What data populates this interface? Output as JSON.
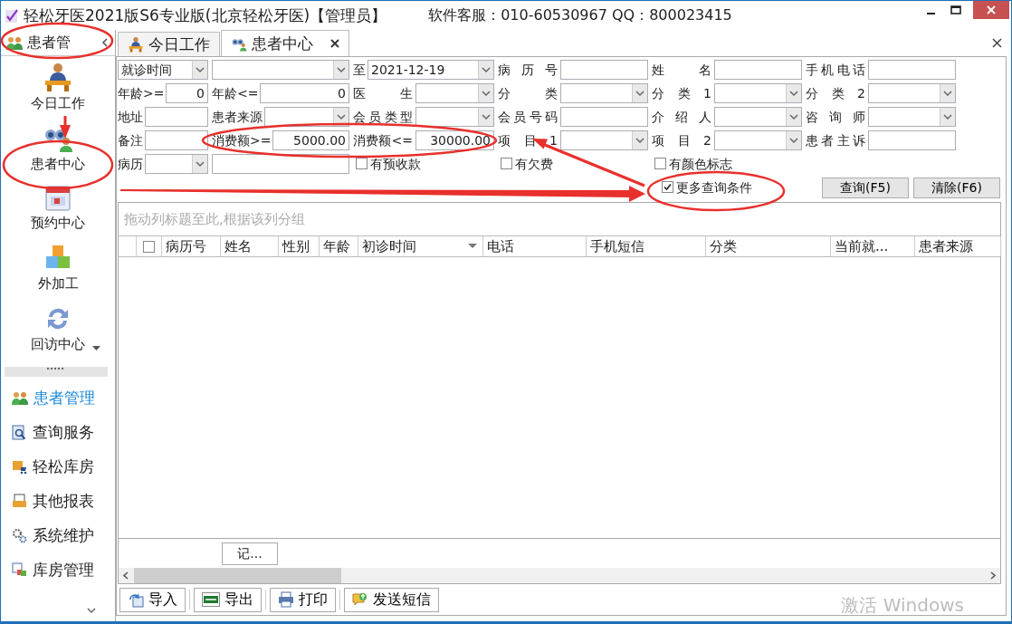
{
  "window": {
    "title": "轻松牙医2021版S6专业版(北京轻松牙医)【管理员】",
    "support": "软件客服：010-60530967 QQ：800023415"
  },
  "sidebar": {
    "header": "患者管",
    "launchers": [
      {
        "label": "今日工作"
      },
      {
        "label": "患者中心"
      },
      {
        "label": "预约中心"
      },
      {
        "label": "外加工"
      },
      {
        "label": "回访中心"
      }
    ],
    "groups": [
      {
        "label": "患者管理",
        "selected": true
      },
      {
        "label": "查询服务",
        "selected": false
      },
      {
        "label": "轻松库房",
        "selected": false
      },
      {
        "label": "其他报表",
        "selected": false
      },
      {
        "label": "系统维护",
        "selected": false
      },
      {
        "label": "库房管理",
        "selected": false
      }
    ]
  },
  "tabs": [
    {
      "label": "今日工作",
      "selected": false,
      "closable": false
    },
    {
      "label": "患者中心",
      "selected": true,
      "closable": true
    }
  ],
  "filters": [
    [
      {
        "kind": "select",
        "value": "就诊时间"
      },
      {
        "kind": "select"
      },
      {
        "label": "至",
        "kind": "select",
        "value": "2021-12-19"
      },
      {
        "label": "病 历 号",
        "kind": "input"
      },
      {
        "label": "姓 名",
        "kind": "input"
      },
      {
        "label": "手机电话",
        "kind": "input"
      }
    ],
    [
      {
        "label": "年龄>=",
        "kind": "number",
        "value": "0"
      },
      {
        "label": "年龄<=",
        "kind": "number",
        "value": "0"
      },
      {
        "label": "医 生",
        "kind": "select"
      },
      {
        "label": "分 类",
        "kind": "select"
      },
      {
        "label": "分类1",
        "kind": "select"
      },
      {
        "label": "分类2",
        "kind": "select"
      }
    ],
    [
      {
        "label": "地址",
        "kind": "input"
      },
      {
        "label": "患者来源",
        "kind": "select"
      },
      {
        "label": "会员类型",
        "kind": "select"
      },
      {
        "label": "会员号码",
        "kind": "input"
      },
      {
        "label": "介 绍 人",
        "kind": "select"
      },
      {
        "label": "咨 询 师",
        "kind": "select"
      }
    ],
    [
      {
        "label": "备注",
        "kind": "input"
      },
      {
        "label": "消费额>=",
        "kind": "number",
        "value": "5000.00"
      },
      {
        "label": "消费额<=",
        "kind": "number",
        "value": "30000.00"
      },
      {
        "label": "项目1",
        "kind": "select"
      },
      {
        "label": "项目2",
        "kind": "select"
      },
      {
        "label": "患者主诉",
        "kind": "input"
      }
    ],
    [
      {
        "label": "病历",
        "kind": "select"
      },
      {
        "kind": "input"
      },
      {
        "kind": "checkbox",
        "label": "有预收款",
        "checked": false
      },
      {
        "kind": "checkbox",
        "label": "有欠费",
        "checked": false
      },
      {
        "kind": "checkbox",
        "label": "有颜色标志",
        "checked": false
      }
    ]
  ],
  "more_conditions": {
    "label": "更多查询条件",
    "checked": true
  },
  "search_buttons": [
    "查询(F5)",
    "清除(F6)"
  ],
  "grid": {
    "group_hint": "拖动列标题至此,根据该列分组",
    "select_all": false,
    "columns": [
      {
        "label": "病历号",
        "filter_button": false
      },
      {
        "label": "姓名",
        "filter_button": false
      },
      {
        "label": "性别",
        "filter_button": false
      },
      {
        "label": "年龄",
        "filter_button": false
      },
      {
        "label": "初诊时间",
        "filter_button": true
      },
      {
        "label": "电话",
        "filter_button": false
      },
      {
        "label": "手机短信",
        "filter_button": false
      },
      {
        "label": "分类",
        "filter_button": false
      },
      {
        "label": "当前就...",
        "filter_button": false
      },
      {
        "label": "患者来源",
        "filter_button": false
      }
    ],
    "summary": "记..."
  },
  "toolbar": [
    "导入",
    "导出",
    "打印",
    "发送短信"
  ],
  "activation_notice": "激活 Windows"
}
